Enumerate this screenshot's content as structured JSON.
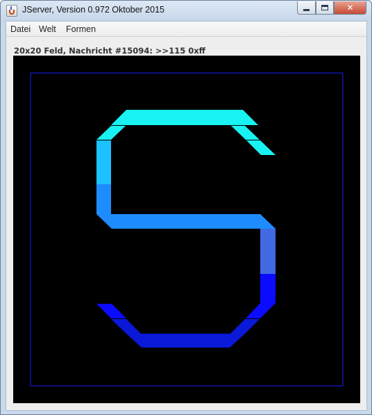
{
  "window": {
    "title": "JServer, Version 0.972 Oktober 2015",
    "app_icon": "java-cup-icon"
  },
  "title_buttons": {
    "minimize_icon": "minimize-icon",
    "maximize_icon": "maximize-icon",
    "close_glyph": "✕"
  },
  "menu": {
    "items": [
      {
        "label": "Datei"
      },
      {
        "label": "Welt"
      },
      {
        "label": "Formen"
      }
    ]
  },
  "status": {
    "text": "20x20 Feld, Nachricht #15094: >>115 0xff"
  },
  "board": {
    "columns": 20,
    "rows": 20,
    "background": "#000000",
    "frame_color": "#1a1aff",
    "letter_drawn": "S",
    "colors": {
      "cyan": "#19f2f2",
      "light_blue": "#1cc1ff",
      "mid_blue": "#1e8cff",
      "steel_blue": "#4169e1",
      "blue": "#0b0bff",
      "dark_blue": "#0a18d8"
    }
  }
}
